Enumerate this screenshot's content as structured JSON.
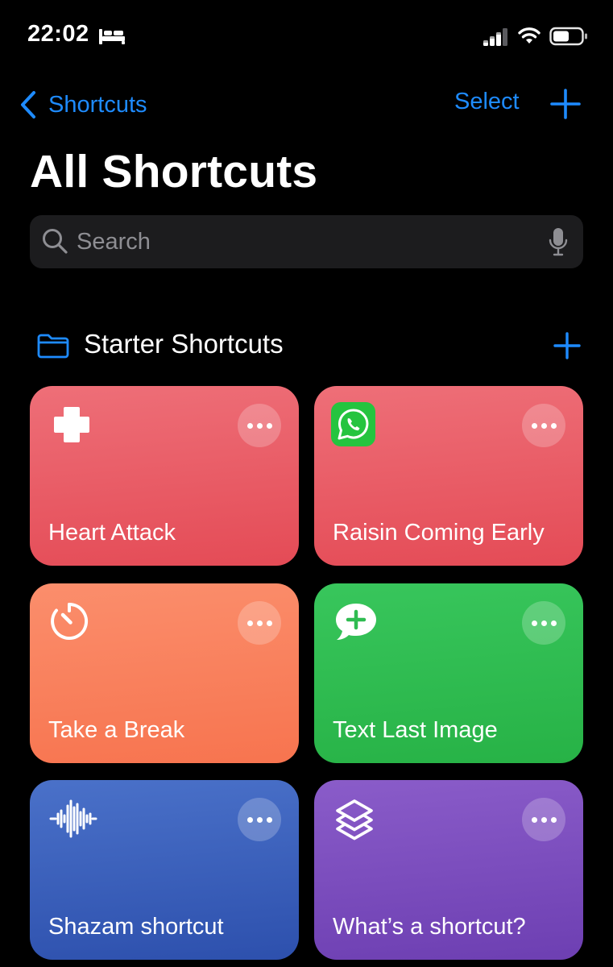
{
  "status_bar": {
    "time": "22:02",
    "icons": [
      "bed-icon",
      "cellular-signal-icon",
      "wifi-icon",
      "battery-icon"
    ]
  },
  "nav": {
    "back_label": "Shortcuts",
    "select_label": "Select",
    "accent_color": "#1e8bff"
  },
  "page_title": "All Shortcuts",
  "search": {
    "placeholder": "Search"
  },
  "section": {
    "title": "Starter Shortcuts",
    "icon": "folder-icon"
  },
  "shortcuts": [
    {
      "title": "Heart Attack",
      "icon": "medical-cross-icon",
      "color": "#e85a64"
    },
    {
      "title": "Raisin Coming Early",
      "icon": "whatsapp-icon",
      "color": "#e85a64"
    },
    {
      "title": "Take a Break",
      "icon": "timer-icon",
      "color": "#f9805c"
    },
    {
      "title": "Text Last Image",
      "icon": "message-add-icon",
      "color": "#2fbc51"
    },
    {
      "title": "Shazam shortcut",
      "icon": "waveform-icon",
      "color": "#3a5fbd"
    },
    {
      "title": "What’s a shortcut?",
      "icon": "shortcuts-layers-icon",
      "color": "#7b4dbd"
    }
  ]
}
